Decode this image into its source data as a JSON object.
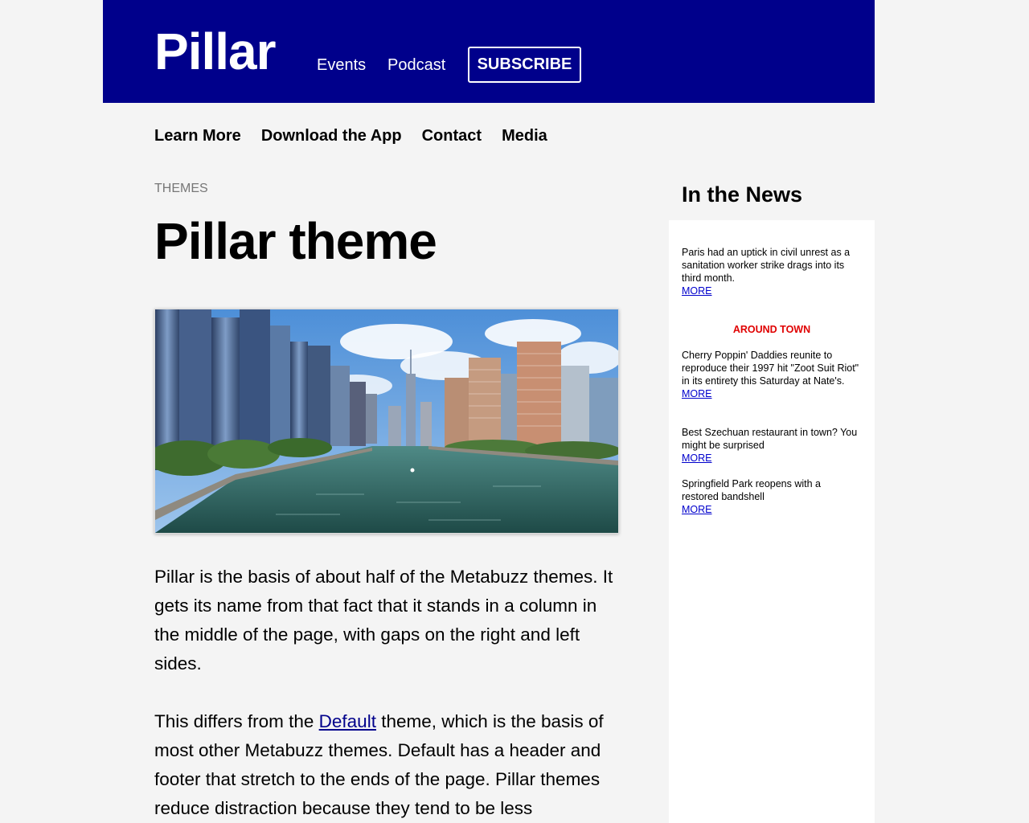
{
  "header": {
    "logo": "Pillar",
    "nav": {
      "events": "Events",
      "podcast": "Podcast",
      "subscribe": "SUBSCRIBE"
    }
  },
  "subnav": {
    "learn_more": "Learn More",
    "download_app": "Download the App",
    "contact": "Contact",
    "media": "Media"
  },
  "article": {
    "kicker": "THEMES",
    "title": "Pillar theme",
    "paragraph1": "Pillar is the basis of about half of the Metabuzz themes. It gets its name from that fact that it stands in a column in the middle of the page, with gaps on the right and left sides.",
    "paragraph2": {
      "before": "This differs from the ",
      "link": "Default",
      "after": " theme, which is the basis of most other Metabuzz themes. Default has a header and footer that stretch to the ends of the page. Pillar themes reduce distraction because they tend to be less"
    }
  },
  "sidebar": {
    "heading": "In the News",
    "items": [
      {
        "text": "Paris had an uptick in civil unrest as a sanitation worker strike drags into its third month.",
        "more": "MORE"
      },
      {
        "text": "Cherry Poppin' Daddies reunite to reproduce their 1997 hit \"Zoot Suit Riot\" in its entirety this Saturday at Nate's.",
        "more": "MORE"
      },
      {
        "text": "Best Szechuan restaurant in town? You might be surprised",
        "more": "MORE"
      },
      {
        "text": "Springfield Park reopens with a restored bandshell",
        "more": "MORE"
      }
    ],
    "section_label": "AROUND TOWN"
  },
  "colors": {
    "header_bg": "#00008b",
    "page_bg": "#f4f4f4",
    "link": "#00008b",
    "section_label": "#e00000"
  }
}
